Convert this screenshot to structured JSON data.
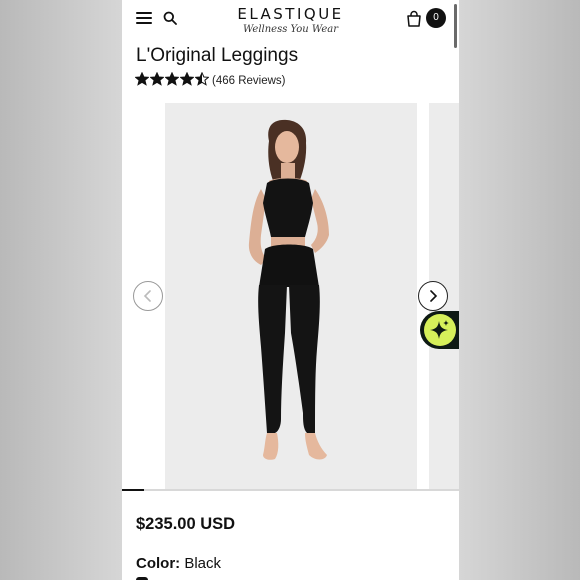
{
  "header": {
    "brand_name": "ELASTIQUE",
    "brand_tagline": "Wellness You Wear",
    "cart_count": "0"
  },
  "product": {
    "title": "L'Original Leggings",
    "rating": 4.5,
    "reviews_text": "(466 Reviews)",
    "price": "$235.00 USD",
    "color_label": "Color:",
    "color_value": "Black"
  },
  "gallery": {
    "progress": 0.065
  },
  "colors": {
    "accent_ai": "#d6f05a",
    "ink": "#111111",
    "photo_bg": "#ececec"
  },
  "icons": [
    "menu-icon",
    "search-icon",
    "shopping-bag-icon",
    "star-icon",
    "chevron-left-icon",
    "chevron-right-icon",
    "sparkle-icon"
  ]
}
